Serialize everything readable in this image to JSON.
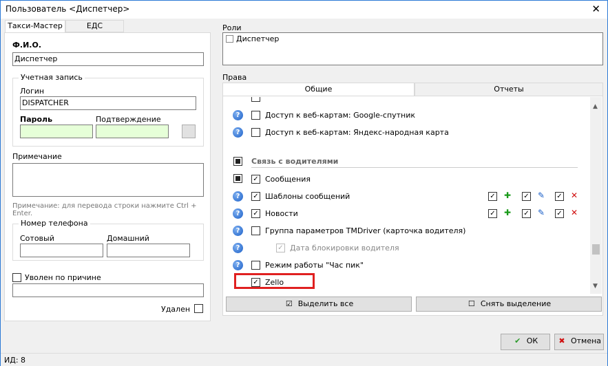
{
  "window": {
    "title": "Пользователь <Диспетчер>"
  },
  "left_tabs": [
    "Такси-Мастер",
    "ЕДС"
  ],
  "form": {
    "fio_label": "Ф.И.О.",
    "fio_value": "Диспетчер",
    "account_group": "Учетная запись",
    "login_label": "Логин",
    "login_value": "DISPATCHER",
    "password_label": "Пароль",
    "confirm_label": "Подтверждение",
    "note_label": "Примечание",
    "note_hint": "Примечание: для перевода строки нажмите Ctrl + Enter.",
    "phone_group": "Номер телефона",
    "mobile_label": "Сотовый",
    "home_label": "Домашний",
    "fired_label": "Уволен по причине",
    "deleted_label": "Удален"
  },
  "roles": {
    "label": "Роли",
    "items": [
      {
        "label": "Диспетчер",
        "checked": false
      }
    ]
  },
  "rights": {
    "label": "Права",
    "tabs": [
      "Общие",
      "Отчеты"
    ],
    "rows": [
      {
        "text": "Доступ к веб-картам: Google-спутник",
        "checked": false
      },
      {
        "text": "Доступ к веб-картам: Яндекс-народная карта",
        "checked": false
      },
      {
        "text": "Связь с водителями"
      },
      {
        "text": "Сообщения",
        "checked": true
      },
      {
        "text": "Шаблоны сообщений",
        "checked": true
      },
      {
        "text": "Новости",
        "checked": true
      },
      {
        "text": "Группа параметров TMDriver (карточка водителя)",
        "checked": false
      },
      {
        "text": "Дата блокировки водителя",
        "checked": true
      },
      {
        "text": "Режим работы \"Час пик\"",
        "checked": false
      },
      {
        "text": "Zello",
        "checked": true
      }
    ],
    "select_all": "Выделить все",
    "deselect": "Снять выделение"
  },
  "buttons": {
    "ok": "ОК",
    "cancel": "Отмена"
  },
  "status": {
    "id": "ИД: 8"
  },
  "colors": {
    "accent": "#2b79d6",
    "highlight": "#e02020",
    "password_field": "#e6ffd8"
  }
}
